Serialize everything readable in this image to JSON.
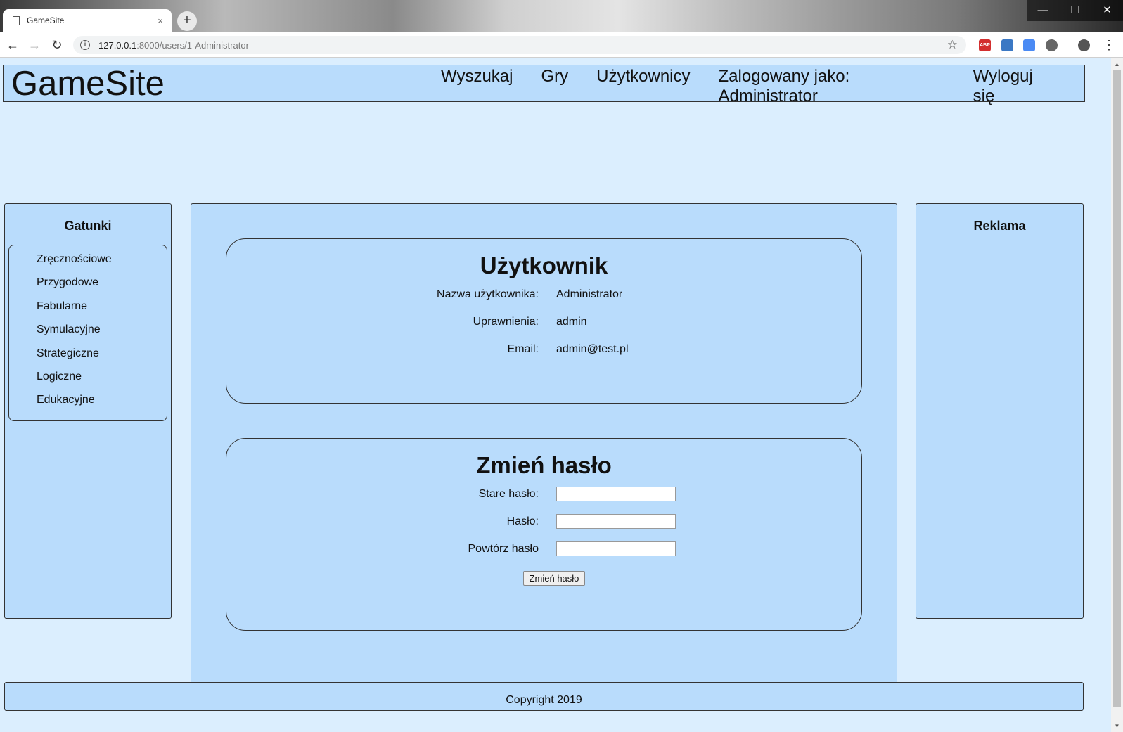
{
  "browser": {
    "tab_title": "GameSite",
    "tab_close": "×",
    "new_tab": "+",
    "url_host": "127.0.0.1",
    "url_rest": ":8000/users/1-Administrator",
    "controls": {
      "minimize": "—",
      "maximize": "☐",
      "close": "✕"
    },
    "nav": {
      "back": "←",
      "forward": "→",
      "reload": "↻",
      "star": "☆",
      "menu": "⋮"
    },
    "extensions": [
      "ABP",
      "cam",
      "translate",
      "ext",
      "profile"
    ]
  },
  "header": {
    "logo": "GameSite",
    "nav": {
      "search": "Wyszukaj",
      "games": "Gry",
      "users": "Użytkownicy",
      "logged_in": "Zalogowany jako: Administrator",
      "logout": "Wyloguj się"
    }
  },
  "sidebar": {
    "title": "Gatunki",
    "genres": [
      "Zręcznościowe",
      "Przygodowe",
      "Fabularne",
      "Symulacyjne",
      "Strategiczne",
      "Logiczne",
      "Edukacyjne"
    ]
  },
  "ads": {
    "title": "Reklama"
  },
  "user_card": {
    "title": "Użytkownik",
    "rows": [
      {
        "label": "Nazwa użytkownika:",
        "value": "Administrator"
      },
      {
        "label": "Uprawnienia:",
        "value": "admin"
      },
      {
        "label": "Email:",
        "value": "admin@test.pl"
      }
    ]
  },
  "password_card": {
    "title": "Zmień hasło",
    "fields": [
      {
        "label": "Stare hasło:",
        "value": ""
      },
      {
        "label": "Hasło:",
        "value": ""
      },
      {
        "label": "Powtórz hasło",
        "value": ""
      }
    ],
    "submit": "Zmień hasło"
  },
  "footer": {
    "text": "Copyright 2019"
  },
  "colors": {
    "page_bg": "#dbeefe",
    "panel_bg": "#b9dcfc",
    "border": "#333333"
  }
}
